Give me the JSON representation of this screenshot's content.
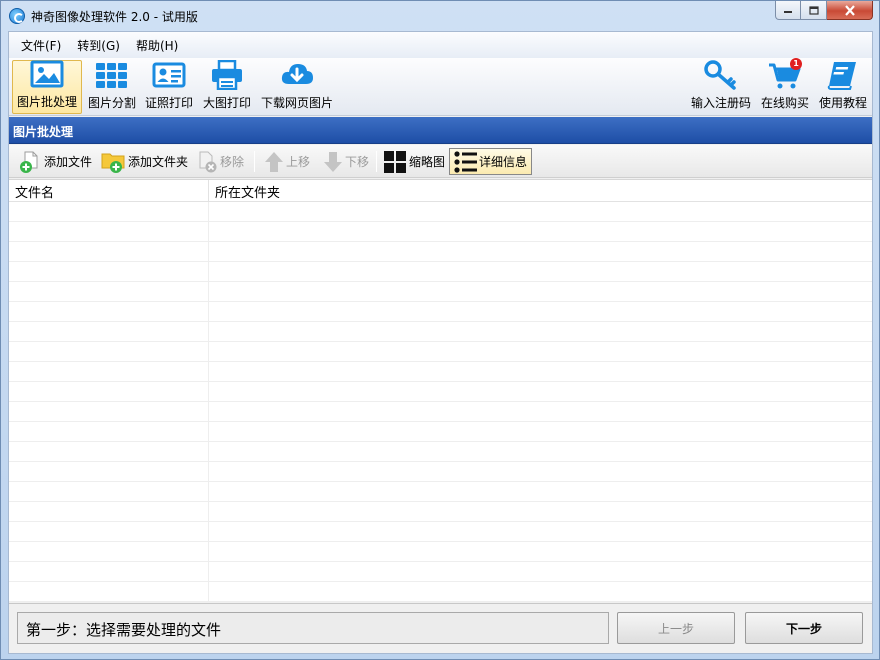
{
  "window": {
    "title": "神奇图像处理软件 2.0 - 试用版",
    "controls": {
      "minimize": "▭",
      "maximize": "□",
      "close": "✕"
    }
  },
  "menu": [
    "文件(F)",
    "转到(G)",
    "帮助(H)"
  ],
  "toolbar": {
    "left": [
      {
        "label": "图片批处理",
        "icon": "image-icon",
        "active": true
      },
      {
        "label": "图片分割",
        "icon": "grid-split-icon"
      },
      {
        "label": "证照打印",
        "icon": "id-card-icon"
      },
      {
        "label": "大图打印",
        "icon": "printer-icon"
      },
      {
        "label": "下载网页图片",
        "icon": "cloud-download-icon"
      }
    ],
    "right": [
      {
        "label": "输入注册码",
        "icon": "key-icon"
      },
      {
        "label": "在线购买",
        "icon": "cart-icon",
        "badge": "1"
      },
      {
        "label": "使用教程",
        "icon": "book-icon"
      }
    ]
  },
  "section_title": "图片批处理",
  "subtoolbar": {
    "add_file": "添加文件",
    "add_folder": "添加文件夹",
    "remove": "移除",
    "move_up": "上移",
    "move_down": "下移",
    "thumbnail": "缩略图",
    "details": "详细信息"
  },
  "table": {
    "columns": [
      "文件名",
      "所在文件夹"
    ],
    "rows": []
  },
  "footer": {
    "step_text": "第一步：选择需要处理的文件",
    "prev": "上一步",
    "next": "下一步"
  },
  "colors": {
    "accent_blue": "#1a8be0",
    "header_blue": "#1e4ea6",
    "badge_red": "#e02020"
  }
}
